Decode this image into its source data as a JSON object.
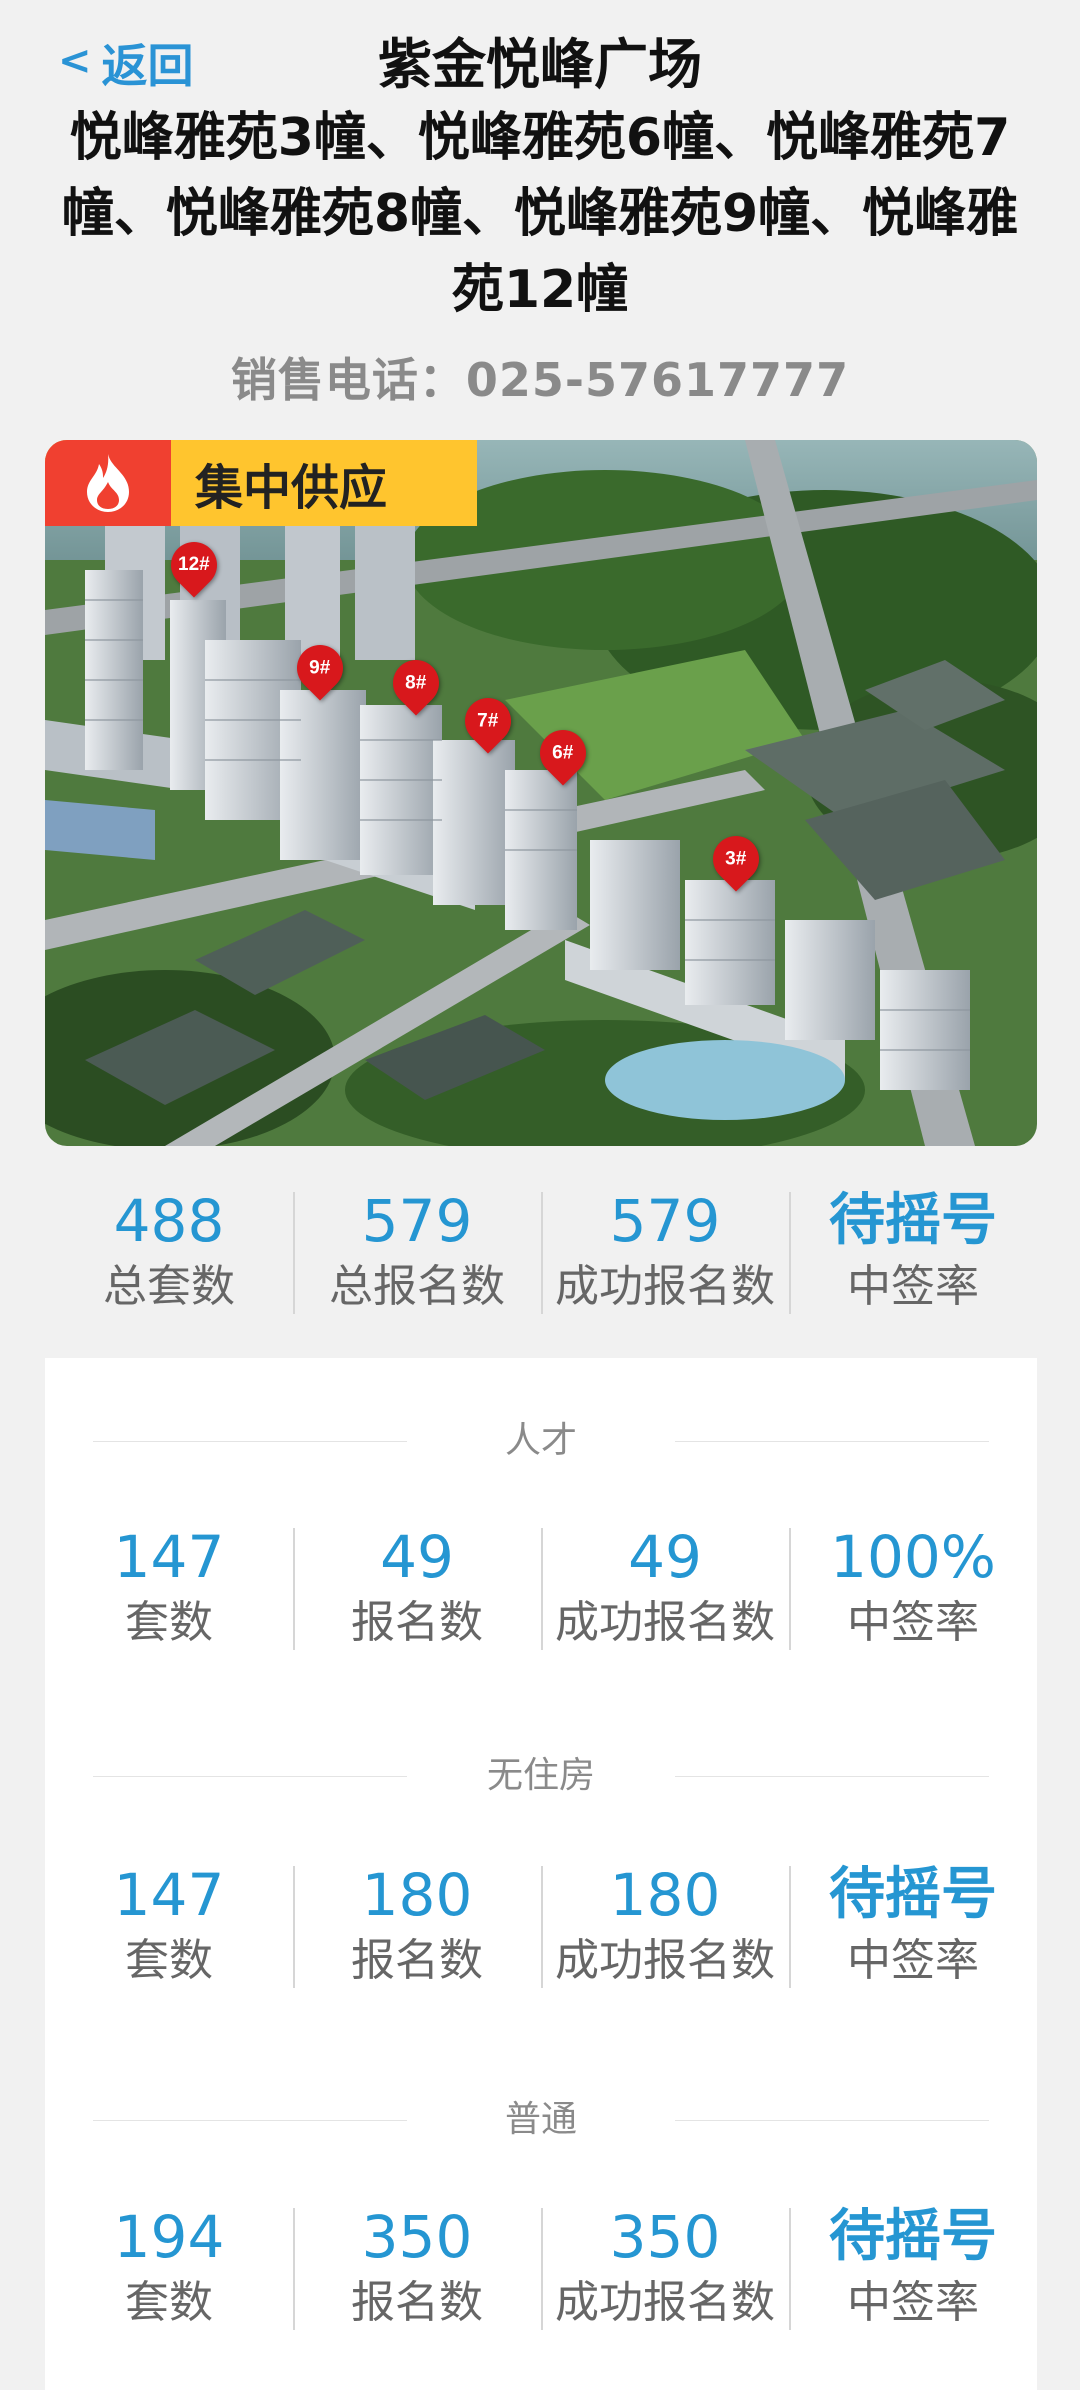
{
  "header": {
    "back_icon": "chevron-left-icon",
    "back_label": "返回",
    "title": "紫金悦峰广场",
    "subtitle": "悦峰雅苑3幢、悦峰雅苑6幢、悦峰雅苑7幢、悦峰雅苑8幢、悦峰雅苑9幢、悦峰雅苑12幢",
    "phone": "销售电话：025-57617777"
  },
  "hero": {
    "badge_icon": "flame-icon",
    "badge_text": "集中供应",
    "pins": [
      "12#",
      "9#",
      "8#",
      "7#",
      "6#",
      "3#"
    ],
    "colors": {
      "badge_bg": "#ffc52e",
      "flame_bg": "#f04030",
      "pin": "#d8181c"
    }
  },
  "summary": [
    {
      "value": "488",
      "label": "总套数"
    },
    {
      "value": "579",
      "label": "总报名数"
    },
    {
      "value": "579",
      "label": "成功报名数"
    },
    {
      "value": "待摇号",
      "label": "中签率"
    }
  ],
  "sections": [
    {
      "title": "人才",
      "stats": [
        {
          "value": "147",
          "label": "套数"
        },
        {
          "value": "49",
          "label": "报名数"
        },
        {
          "value": "49",
          "label": "成功报名数"
        },
        {
          "value": "100%",
          "label": "中签率"
        }
      ]
    },
    {
      "title": "无住房",
      "stats": [
        {
          "value": "147",
          "label": "套数"
        },
        {
          "value": "180",
          "label": "报名数"
        },
        {
          "value": "180",
          "label": "成功报名数"
        },
        {
          "value": "待摇号",
          "label": "中签率"
        }
      ]
    },
    {
      "title": "普通",
      "stats": [
        {
          "value": "194",
          "label": "套数"
        },
        {
          "value": "350",
          "label": "报名数"
        },
        {
          "value": "350",
          "label": "成功报名数"
        },
        {
          "value": "待摇号",
          "label": "中签率"
        }
      ]
    }
  ],
  "colors": {
    "accent": "#2596d2",
    "back": "#2a93d5",
    "background": "#f1f1f1"
  }
}
